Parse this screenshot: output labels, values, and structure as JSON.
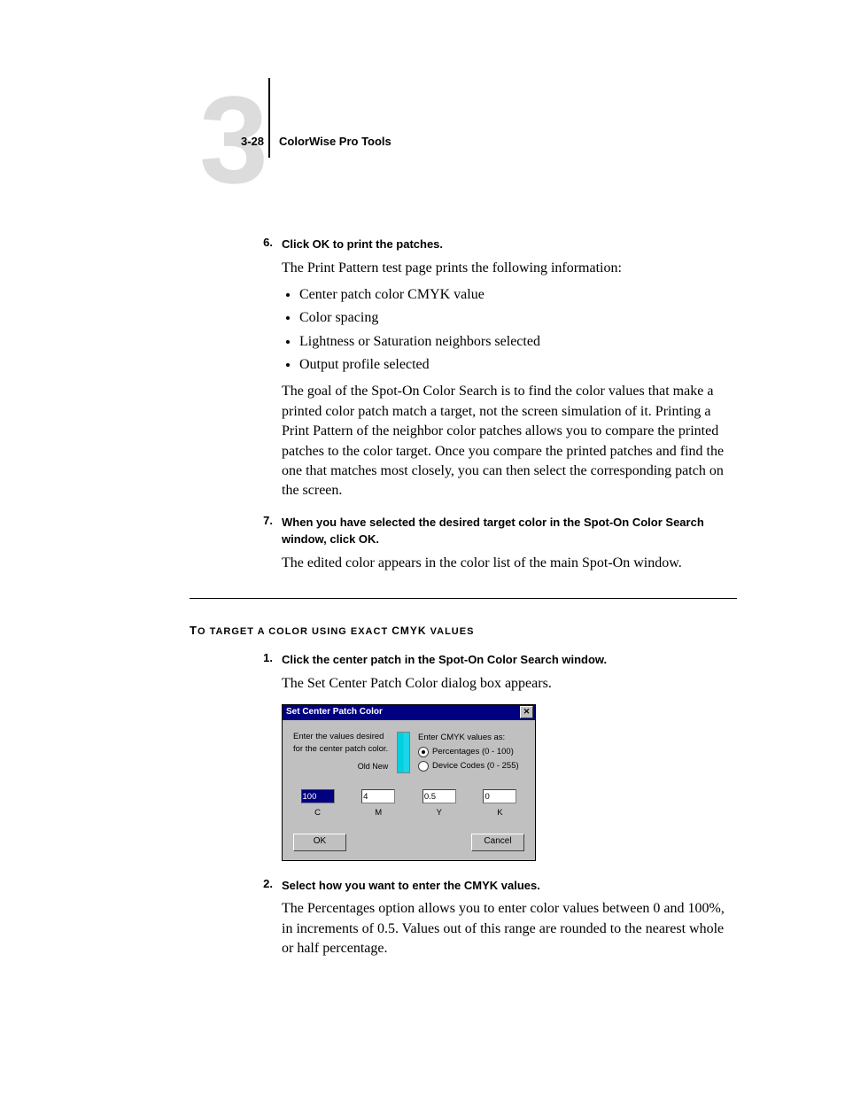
{
  "header": {
    "page_number": "3-28",
    "running_title": "ColorWise Pro Tools",
    "chapter_digit": "3"
  },
  "steps_a": [
    {
      "num": "6.",
      "bold": "Click OK to print the patches.",
      "para1": "The Print Pattern test page prints the following information:",
      "bullets": [
        "Center patch color CMYK value",
        "Color spacing",
        "Lightness or Saturation neighbors selected",
        "Output profile selected"
      ],
      "para2": "The goal of the Spot-On Color Search is to find the color values that make a printed color patch match a target, not the screen simulation of it. Printing a Print Pattern of the neighbor color patches allows you to compare the printed patches to the color target. Once you compare the printed patches and find the one that matches most closely, you can then select the corresponding patch on the screen."
    },
    {
      "num": "7.",
      "bold": "When you have selected the desired target color in the Spot-On Color Search window, click OK.",
      "para1": "The edited color appears in the color list of the main Spot-On window."
    }
  ],
  "section_heading": {
    "first": "T",
    "rest_caps": "O TARGET A COLOR USING EXACT ",
    "cmyk": "CMYK",
    "tail": " VALUES"
  },
  "steps_b": [
    {
      "num": "1.",
      "bold": "Click the center patch in the Spot-On Color Search window.",
      "para1": "The Set Center Patch Color dialog box appears."
    },
    {
      "num": "2.",
      "bold": "Select how you want to enter the CMYK values.",
      "para1": "The Percentages option allows you to enter color values between 0 and 100%, in increments of 0.5. Values out of this range are rounded to the nearest whole or half percentage."
    }
  ],
  "dialog": {
    "title": "Set Center Patch Color",
    "instruction_line1": "Enter the values desired",
    "instruction_line2": "for the center patch color.",
    "old_new": "Old   New",
    "radio_heading": "Enter CMYK values as:",
    "radio_pct": "Percentages (0 - 100)",
    "radio_dev": "Device Codes (0 - 255)",
    "c_value": "100",
    "m_value": "4",
    "y_value": "0.5",
    "k_value": "0",
    "c_label": "C",
    "m_label": "M",
    "y_label": "Y",
    "k_label": "K",
    "ok": "OK",
    "cancel": "Cancel"
  }
}
